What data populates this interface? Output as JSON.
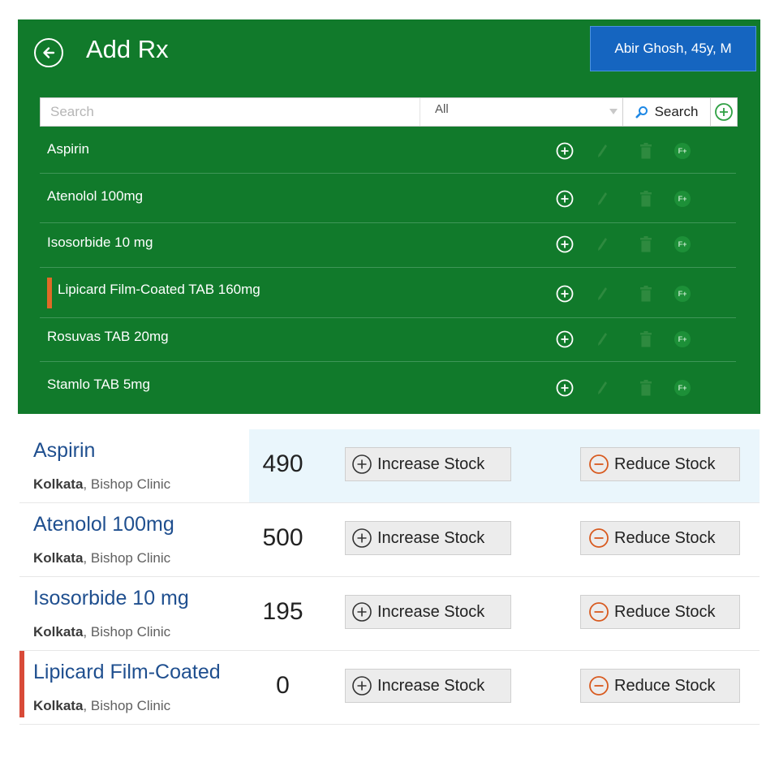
{
  "header": {
    "title": "Add Rx",
    "patient": "Abir Ghosh, 45y, M"
  },
  "search": {
    "placeholder": "Search",
    "value": "",
    "filter_selected": "All",
    "search_label": "Search"
  },
  "rx_list": [
    {
      "name": "Aspirin"
    },
    {
      "name": "Atenolol 100mg"
    },
    {
      "name": "Isosorbide 10 mg"
    },
    {
      "name": "Lipicard Film-Coated TAB 160mg"
    },
    {
      "name": "Rosuvas TAB 20mg"
    },
    {
      "name": "Stamlo TAB 5mg"
    }
  ],
  "rx_action_fav_label": "F+",
  "stock": {
    "increase_label": "Increase Stock",
    "reduce_label": "Reduce Stock",
    "items": [
      {
        "name": "Aspirin",
        "city": "Kolkata",
        "clinic": ", Bishop Clinic",
        "qty": "490"
      },
      {
        "name": "Atenolol 100mg",
        "city": "Kolkata",
        "clinic": ", Bishop Clinic",
        "qty": "500"
      },
      {
        "name": "Isosorbide 10 mg",
        "city": "Kolkata",
        "clinic": ", Bishop Clinic",
        "qty": "195"
      },
      {
        "name": "Lipicard Film-Coated",
        "city": "Kolkata",
        "clinic": ", Bishop Clinic",
        "qty": "0"
      }
    ]
  },
  "colors": {
    "panel_green": "#117a2b",
    "patient_blue": "#1565c0",
    "active_marker_orange": "#e06a27",
    "alert_marker_red": "#d84a38",
    "name_blue": "#1f4f8f",
    "reduce_icon_orange": "#d85a1f"
  },
  "icons": [
    "back-arrow-icon",
    "search-icon",
    "add-circle-icon",
    "pencil-icon",
    "trash-icon",
    "favorite-plus-icon",
    "minus-circle-icon"
  ]
}
